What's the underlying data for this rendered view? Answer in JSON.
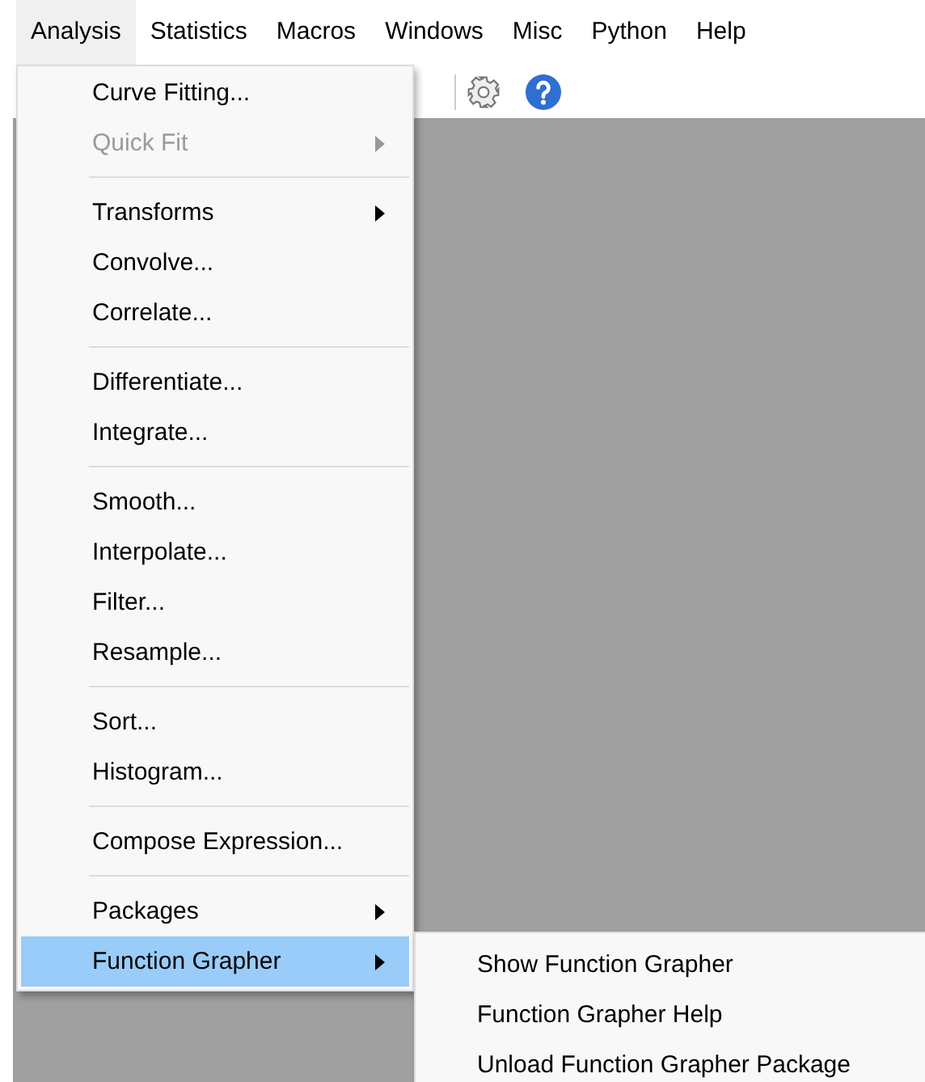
{
  "menubar": [
    {
      "label": "Analysis",
      "selected": true
    },
    {
      "label": "Statistics",
      "selected": false
    },
    {
      "label": "Macros",
      "selected": false
    },
    {
      "label": "Windows",
      "selected": false
    },
    {
      "label": "Misc",
      "selected": false
    },
    {
      "label": "Python",
      "selected": false
    },
    {
      "label": "Help",
      "selected": false
    }
  ],
  "menu": [
    {
      "kind": "item",
      "label": "Curve Fitting...",
      "disabled": false,
      "submenu": false,
      "selected": false
    },
    {
      "kind": "item",
      "label": "Quick Fit",
      "disabled": true,
      "submenu": true,
      "selected": false
    },
    {
      "kind": "separator"
    },
    {
      "kind": "item",
      "label": "Transforms",
      "disabled": false,
      "submenu": true,
      "selected": false
    },
    {
      "kind": "item",
      "label": "Convolve...",
      "disabled": false,
      "submenu": false,
      "selected": false
    },
    {
      "kind": "item",
      "label": "Correlate...",
      "disabled": false,
      "submenu": false,
      "selected": false
    },
    {
      "kind": "separator"
    },
    {
      "kind": "item",
      "label": "Differentiate...",
      "disabled": false,
      "submenu": false,
      "selected": false
    },
    {
      "kind": "item",
      "label": "Integrate...",
      "disabled": false,
      "submenu": false,
      "selected": false
    },
    {
      "kind": "separator"
    },
    {
      "kind": "item",
      "label": "Smooth...",
      "disabled": false,
      "submenu": false,
      "selected": false
    },
    {
      "kind": "item",
      "label": "Interpolate...",
      "disabled": false,
      "submenu": false,
      "selected": false
    },
    {
      "kind": "item",
      "label": "Filter...",
      "disabled": false,
      "submenu": false,
      "selected": false
    },
    {
      "kind": "item",
      "label": "Resample...",
      "disabled": false,
      "submenu": false,
      "selected": false
    },
    {
      "kind": "separator"
    },
    {
      "kind": "item",
      "label": "Sort...",
      "disabled": false,
      "submenu": false,
      "selected": false
    },
    {
      "kind": "item",
      "label": "Histogram...",
      "disabled": false,
      "submenu": false,
      "selected": false
    },
    {
      "kind": "separator"
    },
    {
      "kind": "item",
      "label": "Compose Expression...",
      "disabled": false,
      "submenu": false,
      "selected": false
    },
    {
      "kind": "separator"
    },
    {
      "kind": "item",
      "label": "Packages",
      "disabled": false,
      "submenu": true,
      "selected": false
    },
    {
      "kind": "item",
      "label": "Function Grapher",
      "disabled": false,
      "submenu": true,
      "selected": true
    }
  ],
  "submenu": [
    {
      "label": "Show Function Grapher"
    },
    {
      "label": "Function Grapher Help"
    },
    {
      "label": "Unload Function Grapher Package"
    }
  ]
}
